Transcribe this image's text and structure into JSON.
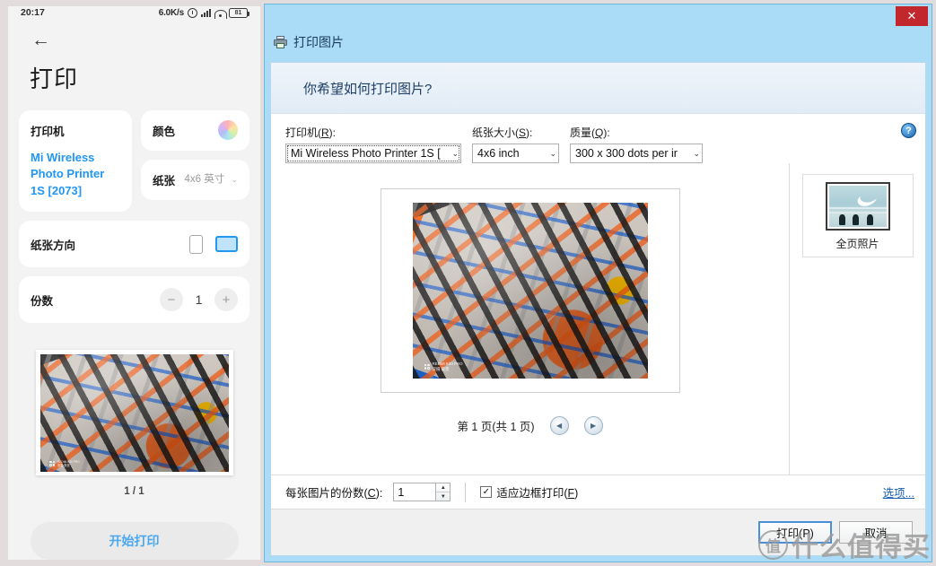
{
  "phone": {
    "status": {
      "time": "20:17",
      "net_speed": "6.0K/s",
      "battery": "81",
      "icons": [
        "alarm-icon",
        "signal-icon",
        "wifi-icon",
        "battery-icon"
      ]
    },
    "back_icon": "←",
    "title": "打印",
    "printer_card": {
      "label": "打印机",
      "value": "Mi Wireless Photo Printer 1S [2073]"
    },
    "color_card": {
      "label": "颜色",
      "swatch": "color-wheel-icon"
    },
    "paper_card": {
      "label": "纸张",
      "value": "4x6 英寸",
      "chevron": "⌄"
    },
    "orientation_card": {
      "label": "纸张方向",
      "portrait": "portrait-icon",
      "landscape": "landscape-icon",
      "selected": "landscape"
    },
    "copies_card": {
      "label": "份数",
      "minus": "−",
      "value": "1",
      "plus": "+"
    },
    "page_indicator": "1 / 1",
    "start_button": "开始打印",
    "photo_watermark": {
      "line1": "REDMI K30 PRO",
      "line2": "双摄 夜景"
    }
  },
  "dialog": {
    "close_label": "✕",
    "titlebar": {
      "icon": "printer-icon",
      "title": "打印图片"
    },
    "banner": "你希望如何打印图片?",
    "help_icon": "?",
    "fields": {
      "printer": {
        "label_pre": "打印机(",
        "label_key": "R",
        "label_post": "):",
        "value": "Mi Wireless Photo Printer 1S ["
      },
      "paper_size": {
        "label_pre": "纸张大小(",
        "label_key": "S",
        "label_post": "):",
        "value": "4x6 inch"
      },
      "quality": {
        "label_pre": "质量(",
        "label_key": "Q",
        "label_post": "):",
        "value": "300 x 300 dots per ir"
      }
    },
    "pager": {
      "text": "第 1 页(共 1 页)",
      "prev": "◀",
      "next": "▶"
    },
    "layout": {
      "label": "全页照片"
    },
    "options": {
      "copies_label_pre": "每张图片的份数(",
      "copies_label_key": "C",
      "copies_label_post": "):",
      "copies_value": "1",
      "fit_frame_pre": "适应边框打印(",
      "fit_frame_key": "F",
      "fit_frame_post": ")",
      "fit_frame_checked": "✓",
      "options_link": "选项..."
    },
    "buttons": {
      "print": "打印(P)",
      "cancel": "取消"
    }
  },
  "watermark": {
    "logo": "值",
    "text": "什么值得买"
  }
}
